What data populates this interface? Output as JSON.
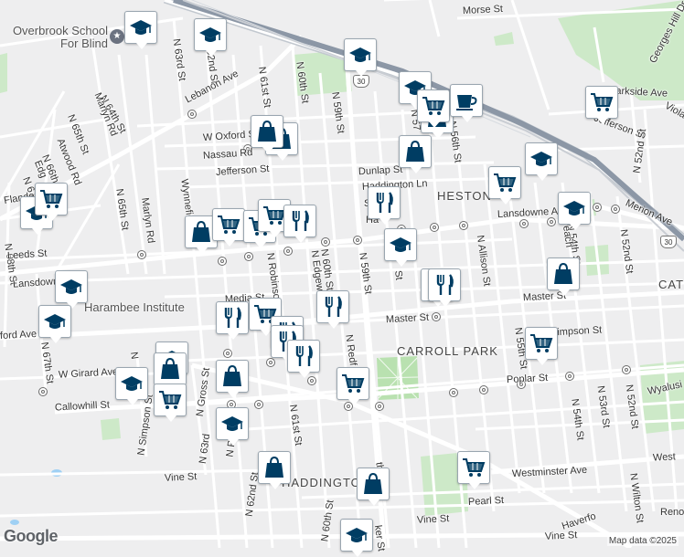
{
  "map": {
    "footer": {
      "google": "Google",
      "copyright": "Map data ©2025"
    },
    "places": [
      {
        "id": "overbrook",
        "text": "Overbrook School For Blind"
      },
      {
        "id": "harambee",
        "text": "Harambee Institute"
      }
    ],
    "areas": [
      {
        "id": "heston",
        "text": "HESTON"
      },
      {
        "id": "carroll-park",
        "text": "CARROLL PARK"
      },
      {
        "id": "haddington",
        "text": "HADDINGTON"
      },
      {
        "id": "catt",
        "text": "CAT"
      }
    ],
    "streets": [
      {
        "id": "morse",
        "text": "Morse St"
      },
      {
        "id": "n64th",
        "text": "N 64th St"
      },
      {
        "id": "n63rd-top",
        "text": "N 63rd St"
      },
      {
        "id": "n62nd-top",
        "text": "N 62nd St"
      },
      {
        "id": "lebanon",
        "text": "Lebanon Ave"
      },
      {
        "id": "n61st-top",
        "text": "N 61st St"
      },
      {
        "id": "n60th-top",
        "text": "N 60th St"
      },
      {
        "id": "n59th-top",
        "text": "N 59th St"
      },
      {
        "id": "marlyn-top",
        "text": "Marlyn Rd"
      },
      {
        "id": "n65th-top",
        "text": "N 65th St"
      },
      {
        "id": "atwood",
        "text": "Atwood Rd"
      },
      {
        "id": "n66th",
        "text": "N 66th St"
      },
      {
        "id": "edg",
        "text": "Edg"
      },
      {
        "id": "n67-top",
        "text": "N 67"
      },
      {
        "id": "flanders",
        "text": "Flanders Rd"
      },
      {
        "id": "woxford",
        "text": "W Oxford St"
      },
      {
        "id": "nassau",
        "text": "Nassau Rd"
      },
      {
        "id": "jefferson-w",
        "text": "Jefferson St"
      },
      {
        "id": "dunlap",
        "text": "Dunlap St"
      },
      {
        "id": "haddington-ln",
        "text": "Haddington Ln"
      },
      {
        "id": "hawk",
        "text": "Ha"
      },
      {
        "id": "n56th-top",
        "text": "N 56th St"
      },
      {
        "id": "n57",
        "text": "N 57"
      },
      {
        "id": "sst",
        "text": "St"
      },
      {
        "id": "parkside",
        "text": "Parkside Ave"
      },
      {
        "id": "jefferson-e",
        "text": "Jefferson St"
      },
      {
        "id": "georges-hill",
        "text": "Georges Hill Dr"
      },
      {
        "id": "n52nd-top",
        "text": "N 52nd St"
      },
      {
        "id": "merion",
        "text": "Merion Ave"
      },
      {
        "id": "viola",
        "text": "Viola"
      },
      {
        "id": "lansdowne-e",
        "text": "Lansdowne Ave"
      },
      {
        "id": "n65th-mid",
        "text": "N 65th St"
      },
      {
        "id": "marlyn-mid",
        "text": "Marlyn Rd"
      },
      {
        "id": "wynnefield",
        "text": "Wynnefield Rd"
      },
      {
        "id": "n68th",
        "text": "N 68th St"
      },
      {
        "id": "leeds",
        "text": "Leeds St"
      },
      {
        "id": "lansdowne-w",
        "text": "Lansdowne Ave"
      },
      {
        "id": "n-robinson",
        "text": "N Robinson"
      },
      {
        "id": "n-edgewood",
        "text": "N Edgewood"
      },
      {
        "id": "n60th-mid",
        "text": "N 60th St"
      },
      {
        "id": "n59th-mid",
        "text": "N 59th St"
      },
      {
        "id": "n-allison",
        "text": "N Allison St"
      },
      {
        "id": "n54th",
        "text": "N 54th St"
      },
      {
        "id": "peach",
        "text": "Peach"
      },
      {
        "id": "n52nd-mid",
        "text": "N 52nd St"
      },
      {
        "id": "media",
        "text": "Media St"
      },
      {
        "id": "master-e",
        "text": "Master St"
      },
      {
        "id": "master-w",
        "text": "Master St"
      },
      {
        "id": "ford-ave",
        "text": "ford Ave"
      },
      {
        "id": "n67th",
        "text": "N 67th St"
      },
      {
        "id": "wgirard",
        "text": "W Girard Ave"
      },
      {
        "id": "n-st-short",
        "text": "N"
      },
      {
        "id": "n-simpson",
        "text": "N Simpson St"
      },
      {
        "id": "n-gross",
        "text": "N Gross St"
      },
      {
        "id": "n-redfield",
        "text": "N Redf"
      },
      {
        "id": "n55th",
        "text": "N 55th St"
      },
      {
        "id": "simpson",
        "text": "Simpson St"
      },
      {
        "id": "poplar",
        "text": "Poplar St"
      },
      {
        "id": "n54th-low",
        "text": "N 54th St"
      },
      {
        "id": "n53rd",
        "text": "N 53rd St"
      },
      {
        "id": "n52nd-low",
        "text": "N 52nd St"
      },
      {
        "id": "wyalusing",
        "text": "Wyalusi"
      },
      {
        "id": "callowhill",
        "text": "Callowhill St"
      },
      {
        "id": "n63rd-low",
        "text": "N 63rd"
      },
      {
        "id": "n-p",
        "text": "N P"
      },
      {
        "id": "n61st-low",
        "text": "N 61st St"
      },
      {
        "id": "n62nd-low",
        "text": "N 62nd St"
      },
      {
        "id": "n60th-low",
        "text": "N 60th St"
      },
      {
        "id": "vine-w",
        "text": "Vine St"
      },
      {
        "id": "vine-mid",
        "text": "Vine St"
      },
      {
        "id": "vine-e",
        "text": "Vine St"
      },
      {
        "id": "westminster",
        "text": "Westminster Ave"
      },
      {
        "id": "west-e",
        "text": "West"
      },
      {
        "id": "pearl",
        "text": "Pearl St"
      },
      {
        "id": "haverford",
        "text": "Haverfo"
      },
      {
        "id": "n-wilton",
        "text": "N Wilton St"
      },
      {
        "id": "reno",
        "text": "Reno"
      },
      {
        "id": "th-st",
        "text": "th St"
      },
      {
        "id": "sst-low",
        "text": "St"
      },
      {
        "id": "n-56-low",
        "text": "N 5"
      },
      {
        "id": "ker",
        "text": "ker St"
      }
    ],
    "route_shields": [
      {
        "id": "us30-top",
        "text": "30"
      },
      {
        "id": "us30-right",
        "text": "30"
      }
    ],
    "markers": [
      {
        "id": "school-1",
        "category": "school",
        "icon": "graduation-cap-icon"
      },
      {
        "id": "school-2",
        "category": "school",
        "icon": "graduation-cap-icon"
      },
      {
        "id": "school-3",
        "category": "school",
        "icon": "graduation-cap-icon"
      },
      {
        "id": "school-4",
        "category": "school",
        "icon": "graduation-cap-icon"
      },
      {
        "id": "school-5",
        "category": "school",
        "icon": "graduation-cap-icon"
      },
      {
        "id": "school-6",
        "category": "school",
        "icon": "graduation-cap-icon"
      },
      {
        "id": "school-7",
        "category": "school",
        "icon": "graduation-cap-icon"
      },
      {
        "id": "school-8",
        "category": "school",
        "icon": "graduation-cap-icon"
      },
      {
        "id": "school-9",
        "category": "school",
        "icon": "graduation-cap-icon"
      },
      {
        "id": "school-10",
        "category": "school",
        "icon": "graduation-cap-icon"
      },
      {
        "id": "school-11",
        "category": "school",
        "icon": "graduation-cap-icon"
      },
      {
        "id": "school-12",
        "category": "school",
        "icon": "graduation-cap-icon"
      },
      {
        "id": "school-13",
        "category": "school",
        "icon": "graduation-cap-icon"
      },
      {
        "id": "school-14",
        "category": "school",
        "icon": "graduation-cap-icon"
      },
      {
        "id": "bag-1",
        "category": "store",
        "icon": "shopping-bag-icon"
      },
      {
        "id": "bag-2",
        "category": "store",
        "icon": "shopping-bag-icon"
      },
      {
        "id": "bag-3",
        "category": "store",
        "icon": "shopping-bag-icon"
      },
      {
        "id": "bag-4",
        "category": "store",
        "icon": "shopping-bag-icon"
      },
      {
        "id": "bag-5",
        "category": "store",
        "icon": "shopping-bag-icon"
      },
      {
        "id": "bag-6",
        "category": "store",
        "icon": "shopping-bag-icon"
      },
      {
        "id": "bag-7",
        "category": "store",
        "icon": "shopping-bag-icon"
      },
      {
        "id": "bag-8",
        "category": "store",
        "icon": "shopping-bag-icon"
      },
      {
        "id": "bag-9",
        "category": "store",
        "icon": "shopping-bag-icon"
      },
      {
        "id": "bag-10",
        "category": "store",
        "icon": "shopping-bag-icon"
      },
      {
        "id": "cart-1",
        "category": "grocery",
        "icon": "shopping-cart-icon"
      },
      {
        "id": "cart-2",
        "category": "grocery",
        "icon": "shopping-cart-icon"
      },
      {
        "id": "cart-3",
        "category": "grocery",
        "icon": "shopping-cart-icon"
      },
      {
        "id": "cart-4",
        "category": "grocery",
        "icon": "shopping-cart-icon"
      },
      {
        "id": "cart-5",
        "category": "grocery",
        "icon": "shopping-cart-icon"
      },
      {
        "id": "cart-6",
        "category": "grocery",
        "icon": "shopping-cart-icon"
      },
      {
        "id": "cart-7",
        "category": "grocery",
        "icon": "shopping-cart-icon"
      },
      {
        "id": "cart-8",
        "category": "grocery",
        "icon": "shopping-cart-icon"
      },
      {
        "id": "cart-9",
        "category": "grocery",
        "icon": "shopping-cart-icon"
      },
      {
        "id": "cart-10",
        "category": "grocery",
        "icon": "shopping-cart-icon"
      },
      {
        "id": "cart-11",
        "category": "grocery",
        "icon": "shopping-cart-icon"
      },
      {
        "id": "cart-12",
        "category": "grocery",
        "icon": "shopping-cart-icon"
      },
      {
        "id": "food-1",
        "category": "restaurant",
        "icon": "fork-knife-icon"
      },
      {
        "id": "food-2",
        "category": "restaurant",
        "icon": "fork-knife-icon"
      },
      {
        "id": "food-3",
        "category": "restaurant",
        "icon": "fork-knife-icon"
      },
      {
        "id": "food-4",
        "category": "restaurant",
        "icon": "fork-knife-icon"
      },
      {
        "id": "food-5",
        "category": "restaurant",
        "icon": "fork-knife-icon"
      },
      {
        "id": "food-6",
        "category": "restaurant",
        "icon": "fork-knife-icon"
      },
      {
        "id": "food-7",
        "category": "restaurant",
        "icon": "fork-knife-icon"
      },
      {
        "id": "food-8",
        "category": "restaurant",
        "icon": "fork-knife-icon"
      },
      {
        "id": "food-9",
        "category": "restaurant",
        "icon": "fork-knife-icon"
      },
      {
        "id": "cafe-1",
        "category": "cafe",
        "icon": "coffee-cup-icon"
      }
    ]
  }
}
